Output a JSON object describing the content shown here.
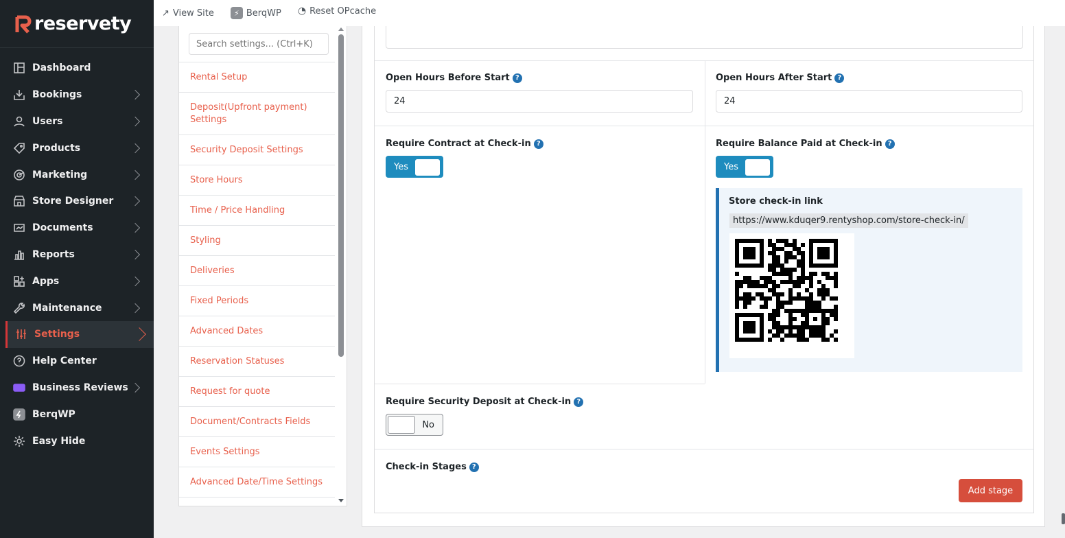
{
  "brand": {
    "name": "reservety",
    "accent": "#e8604c"
  },
  "sidebar": {
    "items": [
      {
        "label": "Dashboard",
        "icon": "dashboard-icon",
        "has_arrow": false
      },
      {
        "label": "Bookings",
        "icon": "bookings-icon",
        "has_arrow": true
      },
      {
        "label": "Users",
        "icon": "users-icon",
        "has_arrow": true
      },
      {
        "label": "Products",
        "icon": "tag-icon",
        "has_arrow": true
      },
      {
        "label": "Marketing",
        "icon": "marketing-icon",
        "has_arrow": true
      },
      {
        "label": "Store Designer",
        "icon": "store-icon",
        "has_arrow": true
      },
      {
        "label": "Documents",
        "icon": "documents-icon",
        "has_arrow": true
      },
      {
        "label": "Reports",
        "icon": "reports-icon",
        "has_arrow": true
      },
      {
        "label": "Apps",
        "icon": "apps-icon",
        "has_arrow": true
      },
      {
        "label": "Maintenance",
        "icon": "wrench-icon",
        "has_arrow": true
      },
      {
        "label": "Settings",
        "icon": "sliders-icon",
        "has_arrow": true,
        "active": true
      },
      {
        "label": "Help Center",
        "icon": "help-icon",
        "has_arrow": false
      },
      {
        "label": "Business Reviews",
        "icon": "reviews-icon",
        "has_arrow": true
      },
      {
        "label": "BerqWP",
        "icon": "berqwp-icon",
        "has_arrow": false
      },
      {
        "label": "Easy Hide",
        "icon": "gear-icon",
        "has_arrow": false
      }
    ]
  },
  "topbar": {
    "view_site": "View Site",
    "berqwp": "BerqWP",
    "reset_opcache": "Reset OPcache"
  },
  "settings_nav": {
    "search_placeholder": "Search settings... (Ctrl+K)",
    "links": [
      "Rental Setup",
      "Deposit(Upfront payment) Settings",
      "Security Deposit Settings",
      "Store Hours",
      "Time / Price Handling",
      "Styling",
      "Deliveries",
      "Fixed Periods",
      "Advanced Dates",
      "Reservation Statuses",
      "Request for quote",
      "Document/Contracts Fields",
      "Events Settings",
      "Advanced Date/Time Settings"
    ]
  },
  "form": {
    "open_before": {
      "label": "Open Hours Before Start",
      "value": "24"
    },
    "open_after": {
      "label": "Open Hours After Start",
      "value": "24"
    },
    "require_contract": {
      "label": "Require Contract at Check-in",
      "state": "Yes"
    },
    "require_balance": {
      "label": "Require Balance Paid at Check-in",
      "state": "Yes"
    },
    "checkin_link": {
      "title": "Store check-in link",
      "url": "https://www.kduqer9.rentyshop.com/store-check-in/"
    },
    "require_security": {
      "label": "Require Security Deposit at Check-in",
      "state": "No"
    },
    "checkin_stages": {
      "label": "Check-in Stages",
      "add_button": "Add stage"
    }
  },
  "colors": {
    "toggle_on": "#1e8cbe",
    "help": "#2271b1",
    "link": "#e8604c",
    "button": "#d64e3c"
  }
}
